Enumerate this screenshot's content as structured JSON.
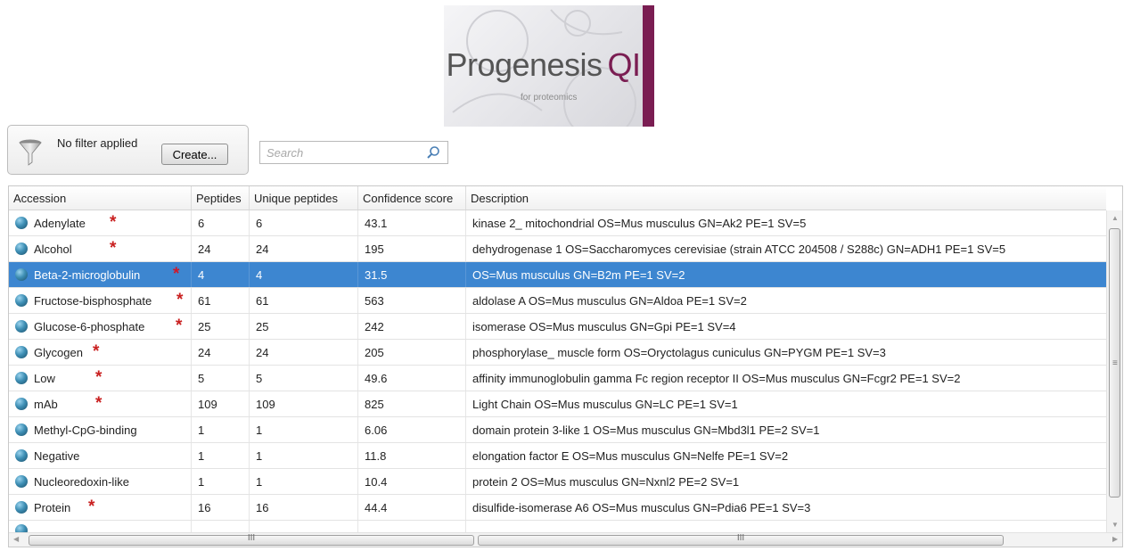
{
  "logo": {
    "name": "Progenesis",
    "suffix": "QI",
    "tagline": "for proteomics",
    "brand_color": "#7a1d52"
  },
  "filter": {
    "icon": "funnel-icon",
    "status": "No filter applied",
    "create_label": "Create..."
  },
  "search": {
    "placeholder": "Search",
    "icon": "magnifier-icon"
  },
  "table": {
    "columns": [
      "Accession",
      "Peptides",
      "Unique peptides",
      "Confidence score",
      "Description"
    ],
    "rows": [
      {
        "accession": "Adenylate",
        "peptides": "6",
        "unique": "6",
        "score": "43.1",
        "description": "kinase 2_ mitochondrial OS=Mus musculus GN=Ak2 PE=1 SV=5",
        "starred": true,
        "selected": false
      },
      {
        "accession": "Alcohol",
        "peptides": "24",
        "unique": "24",
        "score": "195",
        "description": "dehydrogenase 1 OS=Saccharomyces cerevisiae (strain ATCC 204508 / S288c) GN=ADH1 PE=1 SV=5",
        "starred": true,
        "selected": false
      },
      {
        "accession": "Beta-2-microglobulin",
        "peptides": "4",
        "unique": "4",
        "score": "31.5",
        "description": "OS=Mus musculus GN=B2m PE=1 SV=2",
        "starred": true,
        "selected": true
      },
      {
        "accession": "Fructose-bisphosphate",
        "peptides": "61",
        "unique": "61",
        "score": "563",
        "description": "aldolase A OS=Mus musculus GN=Aldoa PE=1 SV=2",
        "starred": true,
        "selected": false
      },
      {
        "accession": "Glucose-6-phosphate",
        "peptides": "25",
        "unique": "25",
        "score": "242",
        "description": "isomerase OS=Mus musculus GN=Gpi PE=1 SV=4",
        "starred": true,
        "selected": false
      },
      {
        "accession": "Glycogen",
        "peptides": "24",
        "unique": "24",
        "score": "205",
        "description": "phosphorylase_ muscle form OS=Oryctolagus cuniculus GN=PYGM PE=1 SV=3",
        "starred": true,
        "selected": false
      },
      {
        "accession": "Low",
        "peptides": "5",
        "unique": "5",
        "score": "49.6",
        "description": "affinity immunoglobulin gamma Fc region receptor II OS=Mus musculus GN=Fcgr2 PE=1 SV=2",
        "starred": true,
        "selected": false
      },
      {
        "accession": "mAb",
        "peptides": "109",
        "unique": "109",
        "score": "825",
        "description": "Light Chain OS=Mus musculus GN=LC PE=1 SV=1",
        "starred": true,
        "selected": false
      },
      {
        "accession": "Methyl-CpG-binding",
        "peptides": "1",
        "unique": "1",
        "score": "6.06",
        "description": "domain protein 3-like 1 OS=Mus musculus GN=Mbd3l1 PE=2 SV=1",
        "starred": false,
        "selected": false
      },
      {
        "accession": "Negative",
        "peptides": "1",
        "unique": "1",
        "score": "11.8",
        "description": "elongation factor E OS=Mus musculus GN=Nelfe PE=1 SV=2",
        "starred": false,
        "selected": false
      },
      {
        "accession": "Nucleoredoxin-like",
        "peptides": "1",
        "unique": "1",
        "score": "10.4",
        "description": "protein 2 OS=Mus musculus GN=Nxnl2 PE=2 SV=1",
        "starred": false,
        "selected": false
      },
      {
        "accession": "Protein",
        "peptides": "16",
        "unique": "16",
        "score": "44.4",
        "description": "disulfide-isomerase A6 OS=Mus musculus GN=Pdia6 PE=1 SV=3",
        "starred": true,
        "selected": false
      }
    ],
    "row_icon": "globe-icon",
    "star_icon": "star-icon",
    "selection_color": "#3d86d0",
    "star_color": "#c92020"
  },
  "scrollbars": {
    "vertical_grip": "≡",
    "horizontal_grip": "III"
  }
}
